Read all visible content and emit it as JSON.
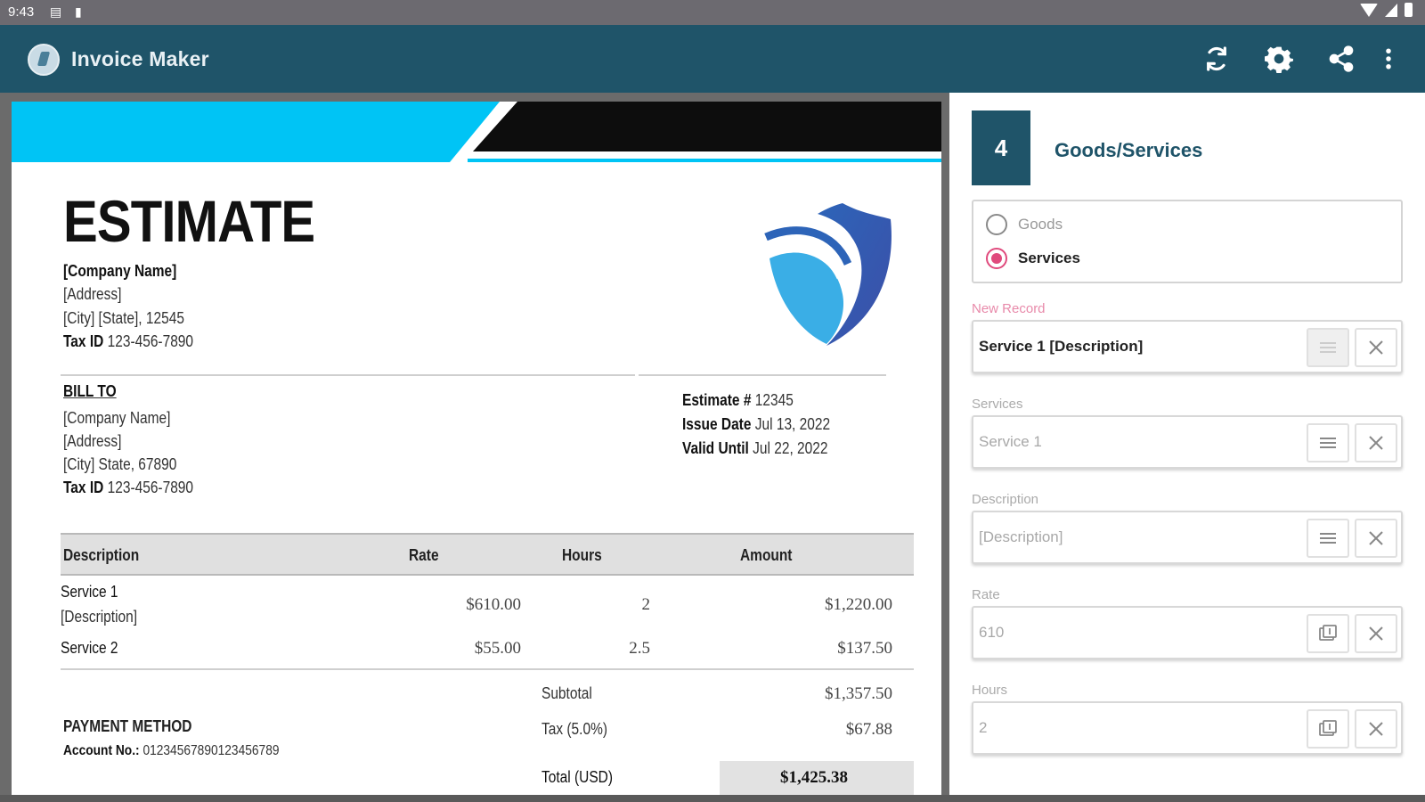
{
  "status_bar": {
    "time": "9:43"
  },
  "app_bar": {
    "title": "Invoice Maker"
  },
  "document": {
    "title": "ESTIMATE",
    "company": {
      "name": "[Company Name]",
      "address": "[Address]",
      "city": "[City] [State], 12545",
      "tax_label": "Tax ID",
      "tax_value": "123-456-7890"
    },
    "bill_to": {
      "heading": "BILL TO",
      "name": "[Company Name]",
      "address": "[Address]",
      "city": "[City] State, 67890",
      "tax_label": "Tax ID",
      "tax_value": "123-456-7890"
    },
    "meta": {
      "estimate_label": "Estimate #",
      "estimate_value": "12345",
      "issue_label": "Issue Date",
      "issue_value": "Jul 13, 2022",
      "valid_label": "Valid Until",
      "valid_value": "Jul 22, 2022"
    },
    "table": {
      "headers": [
        "Description",
        "Rate",
        "Hours",
        "Amount"
      ],
      "rows": [
        {
          "name": "Service 1",
          "desc": "[Description]",
          "rate": "$610.00",
          "hours": "2",
          "amount": "$1,220.00"
        },
        {
          "name": "Service 2",
          "desc": "",
          "rate": "$55.00",
          "hours": "2.5",
          "amount": "$137.50"
        }
      ]
    },
    "totals": {
      "subtotal_label": "Subtotal",
      "subtotal_value": "$1,357.50",
      "tax_label": "Tax (5.0%)",
      "tax_value": "$67.88",
      "total_label": "Total (USD)",
      "total_value": "$1,425.38"
    },
    "payment": {
      "heading": "PAYMENT METHOD",
      "account_label": "Account No.:",
      "account_value": "01234567890123456789"
    }
  },
  "panel": {
    "step_number": "4",
    "step_title": "Goods/Services",
    "options": [
      {
        "label": "Goods",
        "checked": false
      },
      {
        "label": "Services",
        "checked": true
      }
    ],
    "fields": {
      "new_record": {
        "label": "New Record",
        "value": "Service 1 [Description]"
      },
      "services": {
        "label": "Services",
        "value": "Service 1"
      },
      "description": {
        "label": "Description",
        "value": "[Description]"
      },
      "rate": {
        "label": "Rate",
        "value": "610"
      },
      "hours": {
        "label": "Hours",
        "value": "2"
      }
    }
  },
  "colors": {
    "app_bar": "#1f5469",
    "ribbon_cyan": "#00c4f5",
    "ribbon_black": "#0d0d0d",
    "accent_pink": "#e04a7d"
  },
  "icons": [
    "app-logo-icon",
    "refresh-icon",
    "settings-icon",
    "share-icon",
    "more-vert-icon",
    "list-icon",
    "clear-icon",
    "calculator-icon",
    "shield-logo-icon"
  ]
}
